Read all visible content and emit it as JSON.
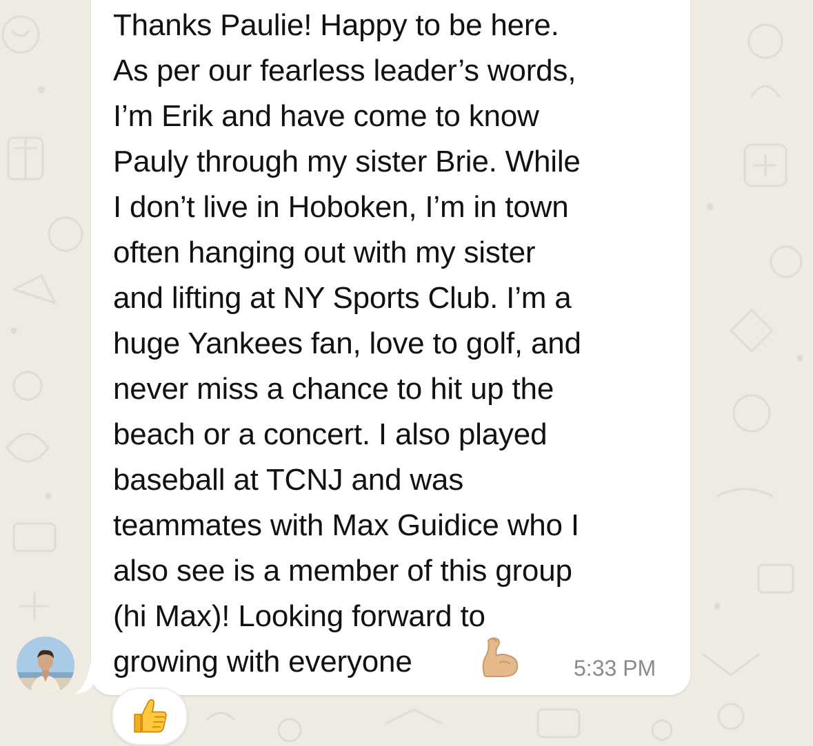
{
  "message": {
    "text": "Thanks Paulie! Happy to be here.\nAs per our fearless leader’s words,\nI’m Erik and have come to know\nPauly through my sister Brie. While\nI don’t live in Hoboken, I’m in town\noften hanging out with my sister\nand lifting at NY Sports Club. I’m a\nhuge Yankees fan, love to golf, and\nnever miss a chance to hit up the\nbeach or a concert. I also played\nbaseball at TCNJ and was\nteammates with Max Guidice who I\nalso see is a member of this group\n(hi Max)! Looking forward to\ngrowing with everyone",
    "emoji_icon": "flexed-biceps-icon",
    "time": "5:33 PM"
  },
  "sender": {
    "avatar_icon": "profile-photo"
  },
  "reaction": {
    "icon": "thumbs-up-icon"
  },
  "colors": {
    "chat_background": "#efeae2",
    "bubble": "#ffffff",
    "timestamp": "#8a8a8a",
    "text": "#111111"
  }
}
